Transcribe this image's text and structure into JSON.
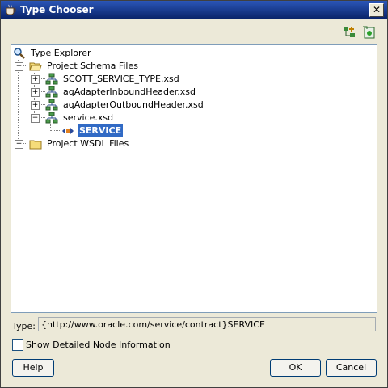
{
  "window": {
    "title": "Type Chooser",
    "close_label": "✕"
  },
  "toolbar": {
    "btn1_icon": "schema-add-icon",
    "btn2_icon": "schema-import-icon"
  },
  "tree": {
    "root": {
      "label": "Type Explorer",
      "icon": "magnifier-icon"
    },
    "project_schema_files": {
      "label": "Project Schema Files",
      "expanded": true
    },
    "schemas": [
      {
        "label": "SCOTT_SERVICE_TYPE.xsd",
        "expanded": false
      },
      {
        "label": "aqAdapterInboundHeader.xsd",
        "expanded": false
      },
      {
        "label": "aqAdapterOutboundHeader.xsd",
        "expanded": false
      },
      {
        "label": "service.xsd",
        "expanded": true
      }
    ],
    "element": {
      "label": "SERVICE",
      "selected": true
    },
    "project_wsdl_files": {
      "label": "Project WSDL Files",
      "expanded": false
    }
  },
  "type_field": {
    "label": "Type:",
    "value": "{http://www.oracle.com/service/contract}SERVICE"
  },
  "checkbox": {
    "label": "Show Detailed Node Information",
    "checked": false
  },
  "buttons": {
    "help": "Help",
    "ok": "OK",
    "cancel": "Cancel"
  }
}
